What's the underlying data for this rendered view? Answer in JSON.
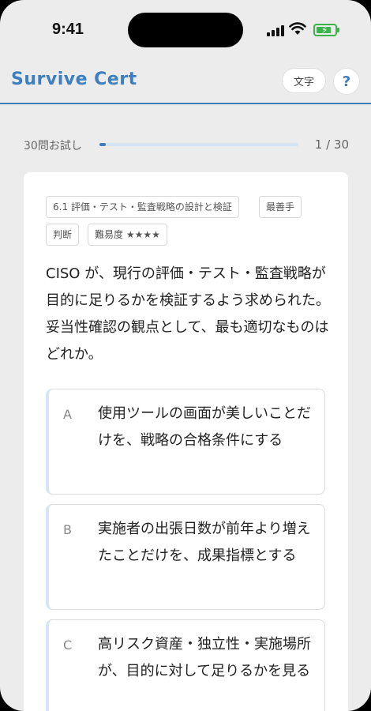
{
  "status_bar": {
    "time": "9:41"
  },
  "header": {
    "app_title": "Survive Cert",
    "text_size_label": "文字",
    "help_label": "?"
  },
  "progress": {
    "label": "30問お試し",
    "current": 1,
    "total": 30,
    "count_text": "1 / 30"
  },
  "question": {
    "tags": [
      "6.1 評価・テスト・監査戦略の設計と検証",
      "最善手",
      "判断",
      "難易度 ★★★★"
    ],
    "text": "CISO が、現行の評価・テスト・監査戦略が目的に足りるかを検証するよう求められた。 妥当性確認の観点として、最も適切なものはどれか。",
    "options": [
      {
        "letter": "A",
        "text": "使用ツールの画面が美しいことだけを、戦略の合格条件にする"
      },
      {
        "letter": "B",
        "text": "実施者の出張日数が前年より増えたことだけを、成果指標とする"
      },
      {
        "letter": "C",
        "text": "高リスク資産・独立性・実施場所が、目的に対して足りるかを見る"
      }
    ]
  },
  "colors": {
    "accent": "#3d7fbf",
    "background": "#ececec",
    "battery": "#3ab54a"
  }
}
